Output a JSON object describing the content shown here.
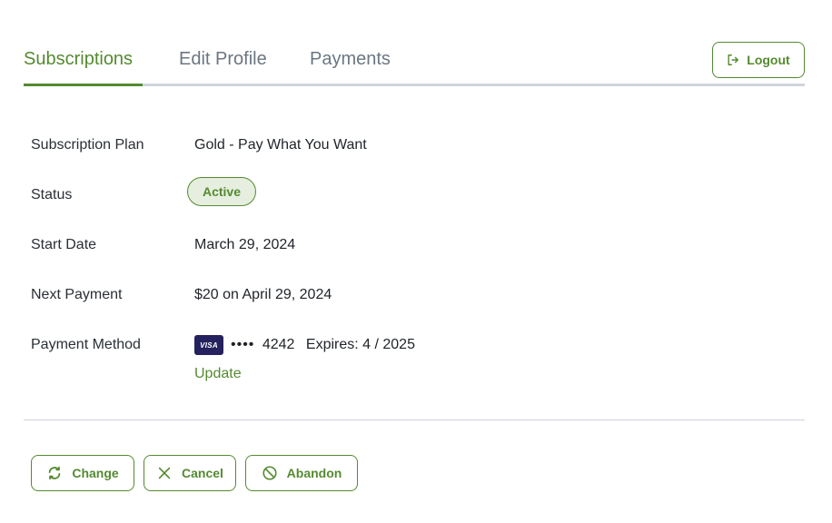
{
  "tabs": [
    {
      "label": "Subscriptions",
      "active": true
    },
    {
      "label": "Edit Profile",
      "active": false
    },
    {
      "label": "Payments",
      "active": false
    }
  ],
  "header": {
    "logout_label": "Logout",
    "logout_icon": "logout-icon"
  },
  "details": {
    "plan_label": "Subscription Plan",
    "plan_value": "Gold - Pay What You Want",
    "status_label": "Status",
    "status_value": "Active",
    "start_label": "Start Date",
    "start_value": "March 29, 2024",
    "next_label": "Next Payment",
    "next_value": "$20 on April 29, 2024",
    "method_label": "Payment Method",
    "card_brand": "VISA",
    "card_mask": "••••",
    "card_last4": "4242",
    "card_expiry": "Expires: 4 / 2025",
    "update_label": "Update"
  },
  "actions": [
    {
      "label": "Change",
      "icon": "refresh-icon"
    },
    {
      "label": "Cancel",
      "icon": "close-icon"
    },
    {
      "label": "Abandon",
      "icon": "prohibited-icon"
    }
  ],
  "colors": {
    "accent": "#548a30",
    "badge_bg": "#e6efdf",
    "tab_inactive": "#6b7682",
    "divider": "#cfd4dc",
    "visa_bg": "#25215e"
  }
}
